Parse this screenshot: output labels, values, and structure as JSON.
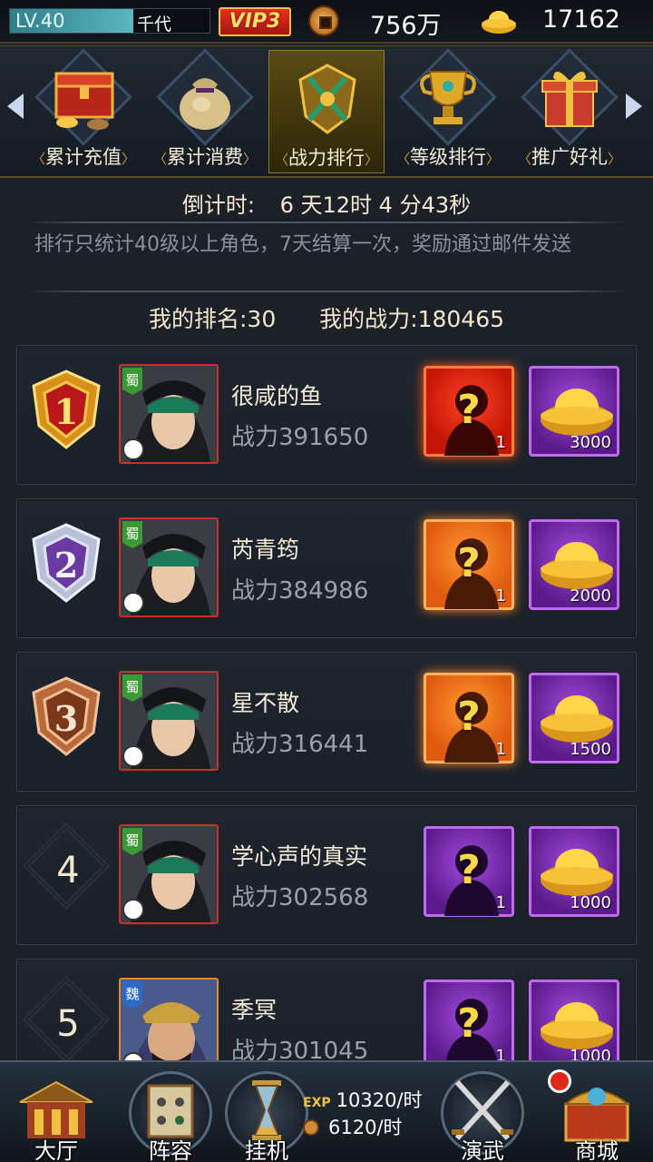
{
  "topbar": {
    "level": "LV.40",
    "level_progress": 0.62,
    "player_name_fragment": "千代",
    "vip": "VIP3",
    "coins": "756万",
    "gold": "17162"
  },
  "tabs": [
    {
      "label": "累计充值",
      "icon": "treasure-chest-icon",
      "active": false
    },
    {
      "label": "累计消费",
      "icon": "money-bag-icon",
      "active": false
    },
    {
      "label": "战力排行",
      "icon": "crossed-swords-emblem-icon",
      "active": true
    },
    {
      "label": "等级排行",
      "icon": "gold-trophy-icon",
      "active": false
    },
    {
      "label": "推广好礼",
      "icon": "gift-box-icon",
      "active": false
    }
  ],
  "info": {
    "countdown_label": "倒计时:",
    "countdown_value": "6 天12时 4 分43秒",
    "notice": "排行只统计40级以上角色，7天结算一次，奖励通过邮件发送",
    "my_rank_label": "我的排名:",
    "my_rank": "30",
    "my_power_label": "我的战力:",
    "my_power": "180465"
  },
  "ranking": [
    {
      "rank": "1",
      "name": "很咸的鱼",
      "power": "战力391650",
      "faction": "蜀",
      "reward_hero_count": "1",
      "reward_gold": "3000"
    },
    {
      "rank": "2",
      "name": "芮青筠",
      "power": "战力384986",
      "faction": "蜀",
      "reward_hero_count": "1",
      "reward_gold": "2000"
    },
    {
      "rank": "3",
      "name": "星不散",
      "power": "战力316441",
      "faction": "蜀",
      "reward_hero_count": "1",
      "reward_gold": "1500"
    },
    {
      "rank": "4",
      "name": "学心声的真实",
      "power": "战力302568",
      "faction": "蜀",
      "reward_hero_count": "1",
      "reward_gold": "1000"
    },
    {
      "rank": "5",
      "name": "季冥",
      "power": "战力301045",
      "faction": "魏",
      "reward_hero_count": "1",
      "reward_gold": "1000"
    }
  ],
  "bottom_nav": {
    "hall": "大厅",
    "lineup": "阵容",
    "idle": "挂机",
    "exp_tag": "EXP",
    "exp_rate": "10320/时",
    "coin_rate": "6120/时",
    "duel": "演武",
    "shop": "商城"
  },
  "colors": {
    "accent_gold": "#f0c040",
    "vip_red": "#c41a10",
    "reward_red": "#c21506",
    "reward_orange": "#e05a10",
    "reward_purple": "#5a1a8a"
  }
}
